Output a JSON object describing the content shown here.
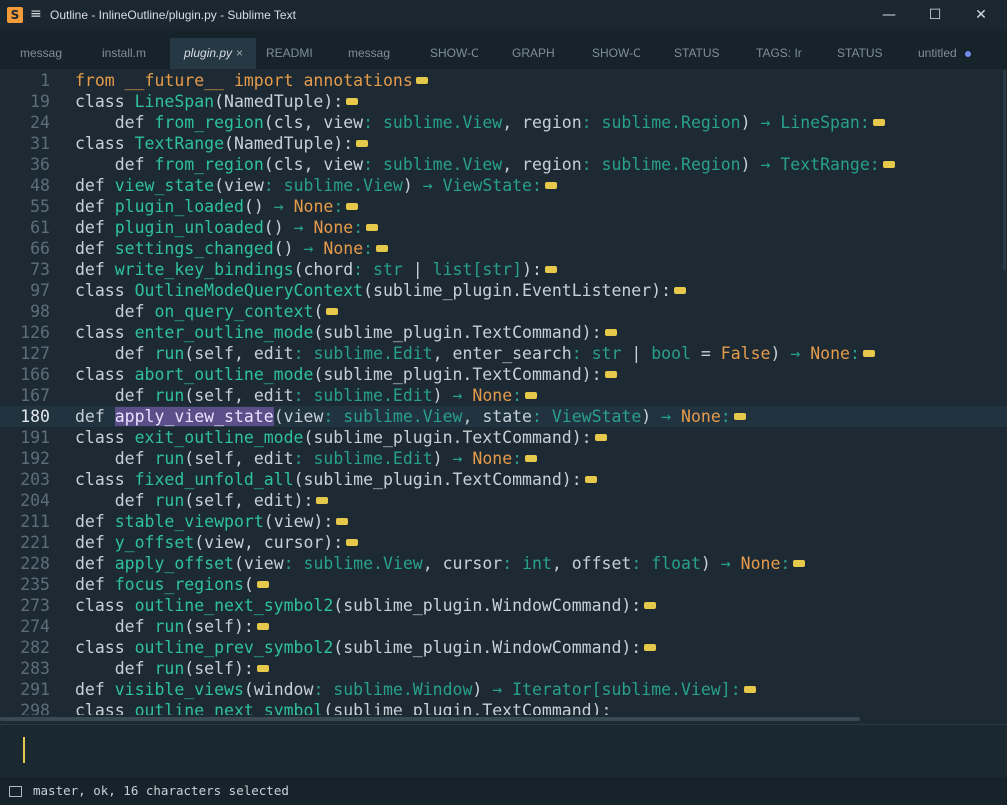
{
  "window": {
    "title": "Outline - InlineOutline/plugin.py - Sublime Text",
    "app_icon": "sublime-icon",
    "controls": [
      "minimize-icon",
      "maximize-icon",
      "close-icon"
    ]
  },
  "tabs": [
    {
      "label": "messag",
      "active": false
    },
    {
      "label": "install.m",
      "active": false
    },
    {
      "label": "plugin.py",
      "active": true,
      "close": "×"
    },
    {
      "label": "READMI",
      "active": false
    },
    {
      "label": "messag",
      "active": false
    },
    {
      "label": "SHOW-C",
      "active": false
    },
    {
      "label": "GRAPH",
      "active": false
    },
    {
      "label": "SHOW-C",
      "active": false
    },
    {
      "label": "STATUS",
      "active": false
    },
    {
      "label": "TAGS: Ir",
      "active": false
    },
    {
      "label": "STATUS",
      "active": false
    },
    {
      "label": "untitled",
      "active": false,
      "modified": true
    }
  ],
  "editor": {
    "current_line": "180",
    "selection": "apply_view_state",
    "lines": [
      {
        "n": "1",
        "tokens": [
          [
            "kw",
            "from __future__ import annotations"
          ]
        ]
      },
      {
        "n": "19",
        "tokens": [
          [
            "k",
            "class "
          ],
          [
            "fn",
            "LineSpan"
          ],
          [
            "pl",
            "(NamedTuple):"
          ]
        ]
      },
      {
        "n": "24",
        "tokens": [
          [
            "k",
            "    def "
          ],
          [
            "fn",
            "from_region"
          ],
          [
            "pl",
            "(cls, view"
          ],
          [
            "ty",
            ": sublime.View"
          ],
          [
            "pl",
            ", region"
          ],
          [
            "ty",
            ": sublime.Region"
          ],
          [
            "pl",
            ") "
          ],
          [
            "ty",
            "→ LineSpan"
          ],
          [
            "ty",
            ":"
          ]
        ]
      },
      {
        "n": "31",
        "tokens": [
          [
            "k",
            "class "
          ],
          [
            "fn",
            "TextRange"
          ],
          [
            "pl",
            "(NamedTuple):"
          ]
        ]
      },
      {
        "n": "36",
        "tokens": [
          [
            "k",
            "    def "
          ],
          [
            "fn",
            "from_region"
          ],
          [
            "pl",
            "(cls, view"
          ],
          [
            "ty",
            ": sublime.View"
          ],
          [
            "pl",
            ", region"
          ],
          [
            "ty",
            ": sublime.Region"
          ],
          [
            "pl",
            ") "
          ],
          [
            "ty",
            "→ TextRange"
          ],
          [
            "ty",
            ":"
          ]
        ]
      },
      {
        "n": "48",
        "tokens": [
          [
            "k",
            "def "
          ],
          [
            "fn",
            "view_state"
          ],
          [
            "pl",
            "(view"
          ],
          [
            "ty",
            ": sublime.View"
          ],
          [
            "pl",
            ") "
          ],
          [
            "ty",
            "→ ViewState"
          ],
          [
            "ty",
            ":"
          ]
        ]
      },
      {
        "n": "55",
        "tokens": [
          [
            "k",
            "def "
          ],
          [
            "fn",
            "plugin_loaded"
          ],
          [
            "pl",
            "() "
          ],
          [
            "ty",
            "→ "
          ],
          [
            "kw",
            "None"
          ],
          [
            "ty",
            ":"
          ]
        ]
      },
      {
        "n": "61",
        "tokens": [
          [
            "k",
            "def "
          ],
          [
            "fn",
            "plugin_unloaded"
          ],
          [
            "pl",
            "() "
          ],
          [
            "ty",
            "→ "
          ],
          [
            "kw",
            "None"
          ],
          [
            "ty",
            ":"
          ]
        ]
      },
      {
        "n": "66",
        "tokens": [
          [
            "k",
            "def "
          ],
          [
            "fn",
            "settings_changed"
          ],
          [
            "pl",
            "() "
          ],
          [
            "ty",
            "→ "
          ],
          [
            "kw",
            "None"
          ],
          [
            "ty",
            ":"
          ]
        ]
      },
      {
        "n": "73",
        "tokens": [
          [
            "k",
            "def "
          ],
          [
            "fn",
            "write_key_bindings"
          ],
          [
            "pl",
            "(chord"
          ],
          [
            "ty",
            ": str"
          ],
          [
            "pl",
            " | "
          ],
          [
            "ty",
            "list[str]"
          ],
          [
            "pl",
            "):"
          ]
        ]
      },
      {
        "n": "97",
        "tokens": [
          [
            "k",
            "class "
          ],
          [
            "fn",
            "OutlineModeQueryContext"
          ],
          [
            "pl",
            "(sublime_plugin.EventListener):"
          ]
        ]
      },
      {
        "n": "98",
        "tokens": [
          [
            "k",
            "    def "
          ],
          [
            "fn",
            "on_query_context"
          ],
          [
            "pl",
            "("
          ]
        ]
      },
      {
        "n": "126",
        "tokens": [
          [
            "k",
            "class "
          ],
          [
            "fn",
            "enter_outline_mode"
          ],
          [
            "pl",
            "(sublime_plugin.TextCommand):"
          ]
        ]
      },
      {
        "n": "127",
        "tokens": [
          [
            "k",
            "    def "
          ],
          [
            "fn",
            "run"
          ],
          [
            "pl",
            "(self, edit"
          ],
          [
            "ty",
            ": sublime.Edit"
          ],
          [
            "pl",
            ", enter_search"
          ],
          [
            "ty",
            ": str"
          ],
          [
            "pl",
            " | "
          ],
          [
            "ty",
            "bool"
          ],
          [
            "pl",
            " = "
          ],
          [
            "kw",
            "False"
          ],
          [
            "pl",
            ") "
          ],
          [
            "ty",
            "→ "
          ],
          [
            "kw",
            "None"
          ],
          [
            "ty",
            ":"
          ]
        ]
      },
      {
        "n": "166",
        "tokens": [
          [
            "k",
            "class "
          ],
          [
            "fn",
            "abort_outline_mode"
          ],
          [
            "pl",
            "(sublime_plugin.TextCommand):"
          ]
        ]
      },
      {
        "n": "167",
        "tokens": [
          [
            "k",
            "    def "
          ],
          [
            "fn",
            "run"
          ],
          [
            "pl",
            "(self, edit"
          ],
          [
            "ty",
            ": sublime.Edit"
          ],
          [
            "pl",
            ") "
          ],
          [
            "ty",
            "→ "
          ],
          [
            "kw",
            "None"
          ],
          [
            "ty",
            ":"
          ]
        ]
      },
      {
        "n": "180",
        "tokens": [
          [
            "k",
            "def "
          ],
          [
            "sel",
            "apply_view_state"
          ],
          [
            "pl",
            "(view"
          ],
          [
            "ty",
            ": sublime.View"
          ],
          [
            "pl",
            ", state"
          ],
          [
            "ty",
            ": ViewState"
          ],
          [
            "pl",
            ") "
          ],
          [
            "ty",
            "→ "
          ],
          [
            "kw",
            "None"
          ],
          [
            "ty",
            ":"
          ]
        ]
      },
      {
        "n": "191",
        "tokens": [
          [
            "k",
            "class "
          ],
          [
            "fn",
            "exit_outline_mode"
          ],
          [
            "pl",
            "(sublime_plugin.TextCommand):"
          ]
        ]
      },
      {
        "n": "192",
        "tokens": [
          [
            "k",
            "    def "
          ],
          [
            "fn",
            "run"
          ],
          [
            "pl",
            "(self, edit"
          ],
          [
            "ty",
            ": sublime.Edit"
          ],
          [
            "pl",
            ") "
          ],
          [
            "ty",
            "→ "
          ],
          [
            "kw",
            "None"
          ],
          [
            "ty",
            ":"
          ]
        ]
      },
      {
        "n": "203",
        "tokens": [
          [
            "k",
            "class "
          ],
          [
            "fn",
            "fixed_unfold_all"
          ],
          [
            "pl",
            "(sublime_plugin.TextCommand):"
          ]
        ]
      },
      {
        "n": "204",
        "tokens": [
          [
            "k",
            "    def "
          ],
          [
            "fn",
            "run"
          ],
          [
            "pl",
            "(self, edit):"
          ]
        ]
      },
      {
        "n": "211",
        "tokens": [
          [
            "k",
            "def "
          ],
          [
            "fn",
            "stable_viewport"
          ],
          [
            "pl",
            "(view):"
          ]
        ]
      },
      {
        "n": "221",
        "tokens": [
          [
            "k",
            "def "
          ],
          [
            "fn",
            "y_offset"
          ],
          [
            "pl",
            "(view, cursor):"
          ]
        ]
      },
      {
        "n": "228",
        "tokens": [
          [
            "k",
            "def "
          ],
          [
            "fn",
            "apply_offset"
          ],
          [
            "pl",
            "(view"
          ],
          [
            "ty",
            ": sublime.View"
          ],
          [
            "pl",
            ", cursor"
          ],
          [
            "ty",
            ": int"
          ],
          [
            "pl",
            ", offset"
          ],
          [
            "ty",
            ": float"
          ],
          [
            "pl",
            ") "
          ],
          [
            "ty",
            "→ "
          ],
          [
            "kw",
            "None"
          ],
          [
            "ty",
            ":"
          ]
        ]
      },
      {
        "n": "235",
        "tokens": [
          [
            "k",
            "def "
          ],
          [
            "fn",
            "focus_regions"
          ],
          [
            "pl",
            "("
          ]
        ]
      },
      {
        "n": "273",
        "tokens": [
          [
            "k",
            "class "
          ],
          [
            "fn",
            "outline_next_symbol2"
          ],
          [
            "pl",
            "(sublime_plugin.WindowCommand):"
          ]
        ]
      },
      {
        "n": "274",
        "tokens": [
          [
            "k",
            "    def "
          ],
          [
            "fn",
            "run"
          ],
          [
            "pl",
            "(self):"
          ]
        ]
      },
      {
        "n": "282",
        "tokens": [
          [
            "k",
            "class "
          ],
          [
            "fn",
            "outline_prev_symbol2"
          ],
          [
            "pl",
            "(sublime_plugin.WindowCommand):"
          ]
        ]
      },
      {
        "n": "283",
        "tokens": [
          [
            "k",
            "    def "
          ],
          [
            "fn",
            "run"
          ],
          [
            "pl",
            "(self):"
          ]
        ]
      },
      {
        "n": "291",
        "tokens": [
          [
            "k",
            "def "
          ],
          [
            "fn",
            "visible_views"
          ],
          [
            "pl",
            "(window"
          ],
          [
            "ty",
            ": sublime.Window"
          ],
          [
            "pl",
            ") "
          ],
          [
            "ty",
            "→ Iterator[sublime.View]"
          ],
          [
            "ty",
            ":"
          ]
        ]
      },
      {
        "n": "298",
        "tokens": [
          [
            "k",
            "class "
          ],
          [
            "fn",
            "outline_next_symbol"
          ],
          [
            "pl",
            "(sublime_plugin.TextCommand):"
          ]
        ]
      }
    ]
  },
  "status": {
    "text": "master, ok, 16 characters selected",
    "icon": "panel-toggle-icon"
  },
  "colors": {
    "background": "#1d2a33",
    "keyword_orange": "#e59b4a",
    "function_green": "#2fc29a",
    "type_teal": "#28a08c",
    "fold_marker": "#e6c84a",
    "selection": "#5b4f8a"
  }
}
